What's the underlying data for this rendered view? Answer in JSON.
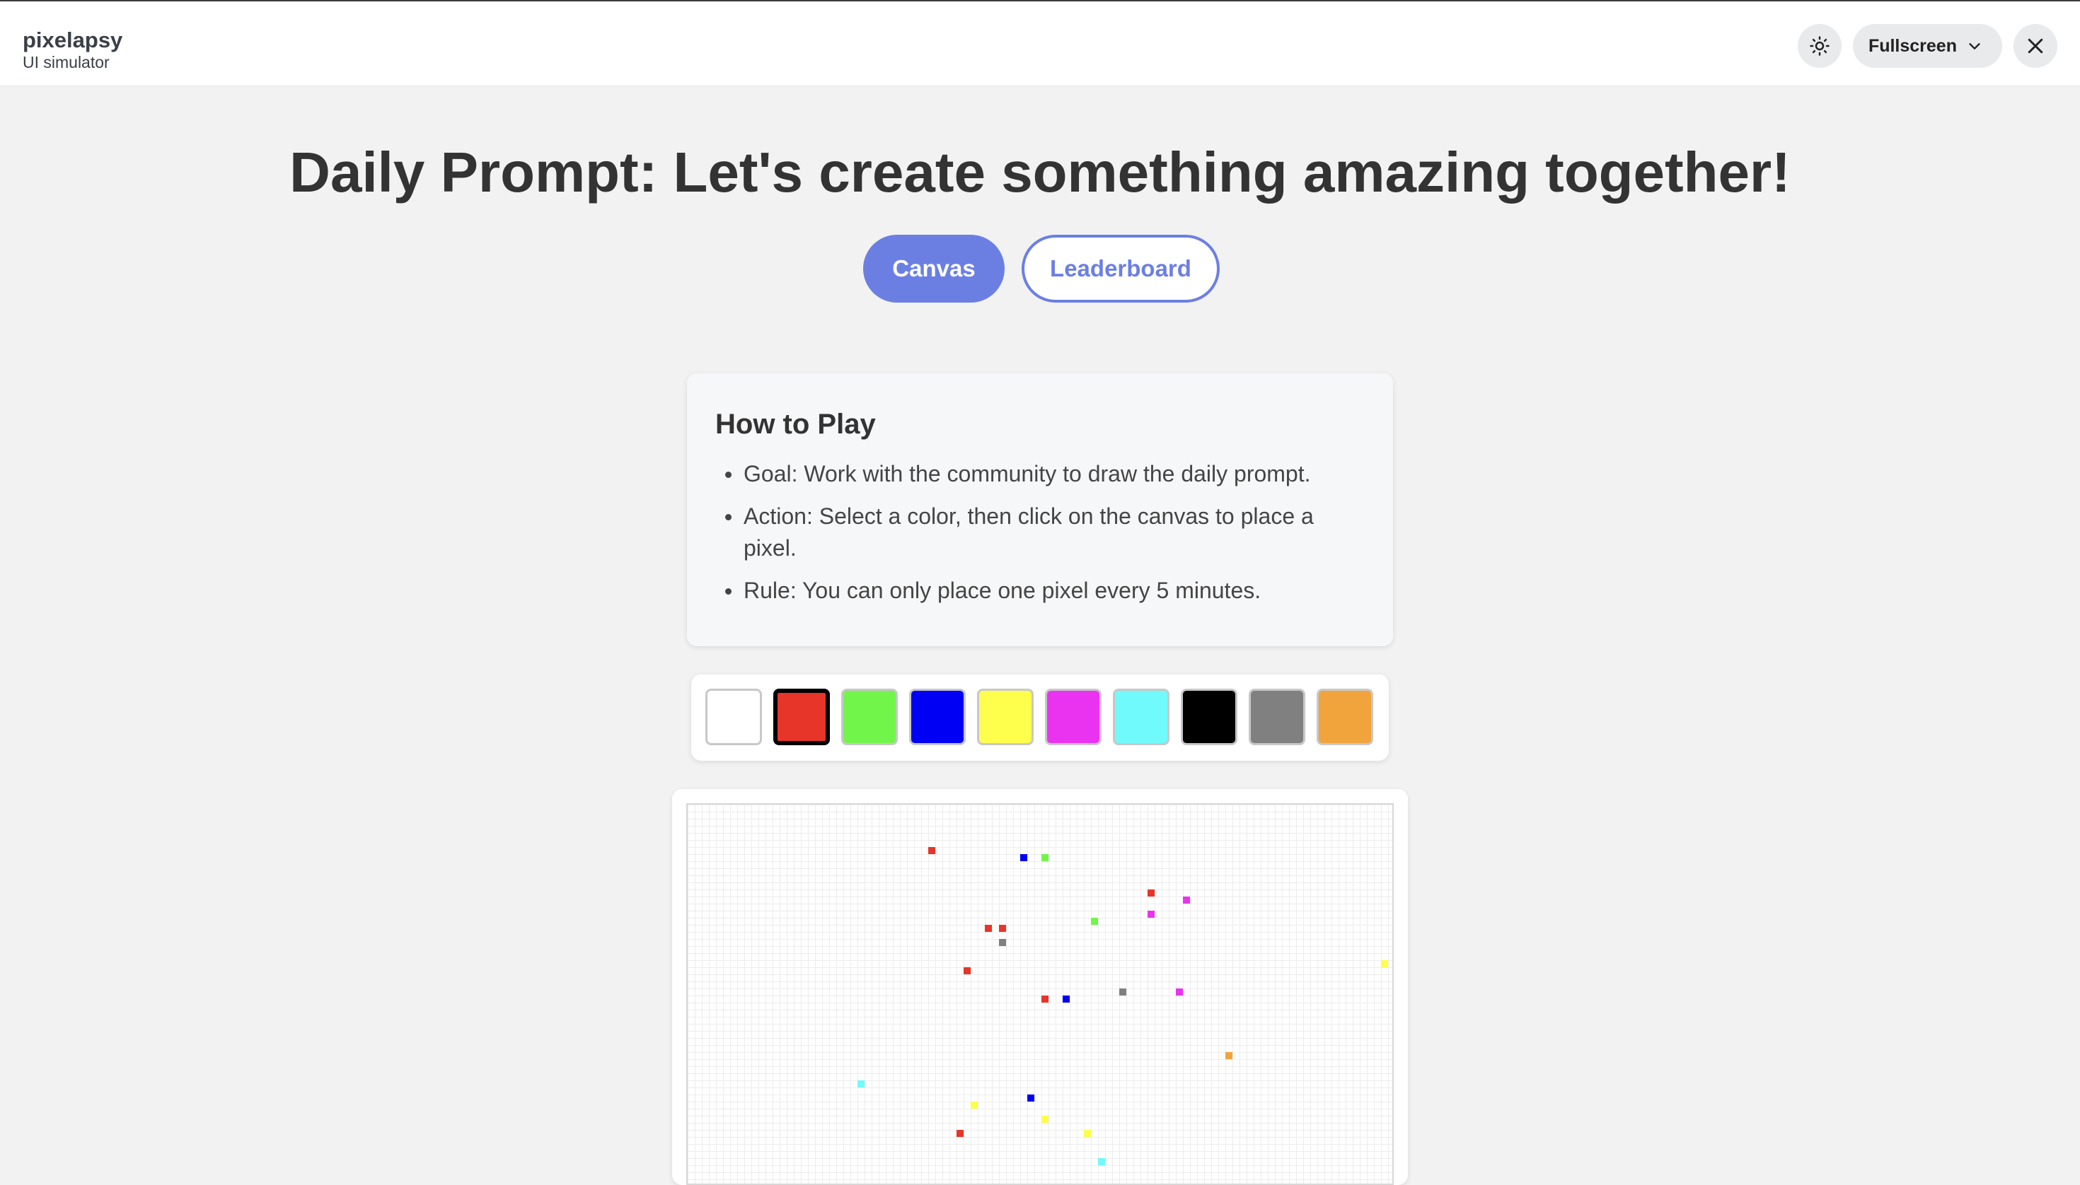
{
  "app": {
    "title": "pixelapsy",
    "subtitle": "UI simulator"
  },
  "controls": {
    "theme_icon": "sun-icon",
    "mode_label": "Fullscreen",
    "mode_icon": "chevron-down-icon",
    "close_icon": "close-icon"
  },
  "heading": "Daily Prompt: Let's create something amazing together!",
  "tabs": [
    {
      "label": "Canvas",
      "active": true
    },
    {
      "label": "Leaderboard",
      "active": false
    }
  ],
  "how_to_play": {
    "title": "How to Play",
    "items": [
      "Goal: Work with the community to draw the daily prompt.",
      "Action: Select a color, then click on the canvas to place a pixel.",
      "Rule: You can only place one pixel every 5 minutes."
    ]
  },
  "palette": {
    "selected_index": 1,
    "colors": [
      "#ffffff",
      "#e8352a",
      "#72f54a",
      "#0000f5",
      "#fefe4c",
      "#ea33f1",
      "#70fafb",
      "#000000",
      "#808080",
      "#f1a43c"
    ]
  },
  "canvas": {
    "pixels": [
      {
        "col": 34,
        "row": 6,
        "color": "#e8352a"
      },
      {
        "col": 47,
        "row": 7,
        "color": "#0000f5"
      },
      {
        "col": 50,
        "row": 7,
        "color": "#72f54a"
      },
      {
        "col": 65,
        "row": 12,
        "color": "#e8352a"
      },
      {
        "col": 70,
        "row": 13,
        "color": "#ea33f1"
      },
      {
        "col": 65,
        "row": 15,
        "color": "#ea33f1"
      },
      {
        "col": 57,
        "row": 16,
        "color": "#72f54a"
      },
      {
        "col": 42,
        "row": 17,
        "color": "#e8352a"
      },
      {
        "col": 44,
        "row": 17,
        "color": "#e8352a"
      },
      {
        "col": 44,
        "row": 19,
        "color": "#808080"
      },
      {
        "col": 39,
        "row": 23,
        "color": "#e8352a"
      },
      {
        "col": 98,
        "row": 22,
        "color": "#fefe4c"
      },
      {
        "col": 61,
        "row": 26,
        "color": "#808080"
      },
      {
        "col": 69,
        "row": 26,
        "color": "#ea33f1"
      },
      {
        "col": 50,
        "row": 27,
        "color": "#e8352a"
      },
      {
        "col": 53,
        "row": 27,
        "color": "#0000f5"
      },
      {
        "col": 76,
        "row": 35,
        "color": "#f1a43c"
      },
      {
        "col": 24,
        "row": 39,
        "color": "#70fafb"
      },
      {
        "col": 48,
        "row": 41,
        "color": "#0000f5"
      },
      {
        "col": 40,
        "row": 42,
        "color": "#fefe4c"
      },
      {
        "col": 50,
        "row": 44,
        "color": "#fefe4c"
      },
      {
        "col": 38,
        "row": 46,
        "color": "#e8352a"
      },
      {
        "col": 56,
        "row": 46,
        "color": "#fefe4c"
      },
      {
        "col": 58,
        "row": 50,
        "color": "#70fafb"
      }
    ]
  }
}
